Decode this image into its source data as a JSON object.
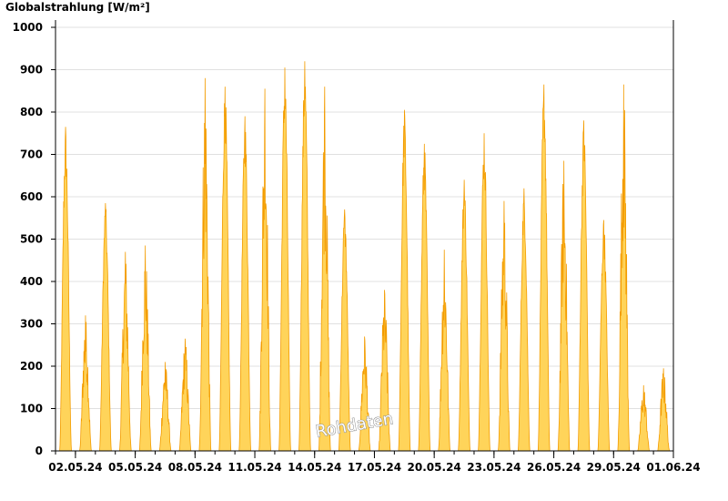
{
  "chart_data": {
    "type": "area",
    "title": "Globalstrahlung [W/m²]",
    "xlabel": "",
    "ylabel": "",
    "ylim": [
      0,
      1020
    ],
    "yticks": [
      0,
      100,
      200,
      300,
      400,
      500,
      600,
      700,
      800,
      900,
      1000
    ],
    "x_start_date": "2024-05-01",
    "x_end_date": "2024-06-01",
    "xtick_labels": [
      "02.05.24",
      "05.05.24",
      "08.05.24",
      "11.05.24",
      "14.05.24",
      "17.05.24",
      "20.05.24",
      "23.05.24",
      "26.05.24",
      "29.05.24",
      "01.06.24"
    ],
    "grid": true,
    "watermark": "Rohdaten",
    "colors": {
      "fill": "#ffd45a",
      "stroke": "#f39c00",
      "grid": "#e0e0e0",
      "axis": "#000000"
    },
    "series": [
      {
        "values_daily_peak": [
          {
            "date": "2024-05-01",
            "peak": 765
          },
          {
            "date": "2024-05-02",
            "peak": 320
          },
          {
            "date": "2024-05-03",
            "peak": 585
          },
          {
            "date": "2024-05-04",
            "peak": 470
          },
          {
            "date": "2024-05-05",
            "peak": 485
          },
          {
            "date": "2024-05-06",
            "peak": 210
          },
          {
            "date": "2024-05-07",
            "peak": 265
          },
          {
            "date": "2024-05-08",
            "peak": 880
          },
          {
            "date": "2024-05-09",
            "peak": 860
          },
          {
            "date": "2024-05-10",
            "peak": 790
          },
          {
            "date": "2024-05-11",
            "peak": 855
          },
          {
            "date": "2024-05-12",
            "peak": 905
          },
          {
            "date": "2024-05-13",
            "peak": 920
          },
          {
            "date": "2024-05-14",
            "peak": 860
          },
          {
            "date": "2024-05-15",
            "peak": 570
          },
          {
            "date": "2024-05-16",
            "peak": 270
          },
          {
            "date": "2024-05-17",
            "peak": 380
          },
          {
            "date": "2024-05-18",
            "peak": 805
          },
          {
            "date": "2024-05-19",
            "peak": 725
          },
          {
            "date": "2024-05-20",
            "peak": 475
          },
          {
            "date": "2024-05-21",
            "peak": 640
          },
          {
            "date": "2024-05-22",
            "peak": 750
          },
          {
            "date": "2024-05-23",
            "peak": 590
          },
          {
            "date": "2024-05-24",
            "peak": 620
          },
          {
            "date": "2024-05-25",
            "peak": 865
          },
          {
            "date": "2024-05-26",
            "peak": 685
          },
          {
            "date": "2024-05-27",
            "peak": 780
          },
          {
            "date": "2024-05-28",
            "peak": 545
          },
          {
            "date": "2024-05-29",
            "peak": 865
          },
          {
            "date": "2024-05-30",
            "peak": 155
          },
          {
            "date": "2024-05-31",
            "peak": 195
          }
        ]
      }
    ]
  }
}
